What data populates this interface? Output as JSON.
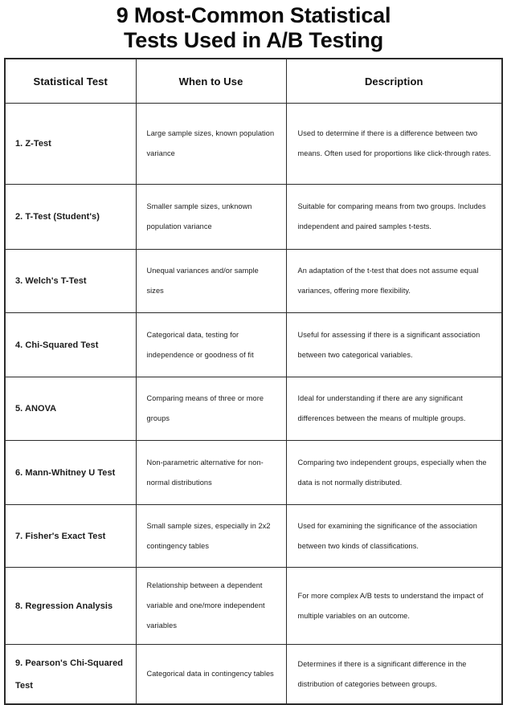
{
  "title": {
    "line1": "9 Most-Common Statistical",
    "line2": "Tests Used in A/B Testing"
  },
  "table": {
    "columns": [
      {
        "header": "Statistical Test"
      },
      {
        "header": "When to Use"
      },
      {
        "header": "Description"
      }
    ],
    "rows": [
      {
        "test": "1. Z-Test",
        "when": "Large sample sizes, known population variance",
        "description": "Used to determine if there is a difference between two means. Often used for proportions like click-through rates."
      },
      {
        "test": "2. T-Test (Student's)",
        "when": "Smaller sample sizes, unknown population variance",
        "description": "Suitable for comparing means from two groups. Includes independent and paired samples t-tests."
      },
      {
        "test": "3. Welch's T-Test",
        "when": "Unequal variances and/or sample sizes",
        "description": "An adaptation of the t-test that does not assume equal variances, offering more flexibility."
      },
      {
        "test": "4. Chi-Squared Test",
        "when": "Categorical data, testing for independence or goodness of fit",
        "description": "Useful for assessing if there is a significant association between two categorical variables."
      },
      {
        "test": "5. ANOVA",
        "when": "Comparing means of three or more groups",
        "description": "Ideal for understanding if there are any significant differences between the means of multiple groups."
      },
      {
        "test": "6. Mann-Whitney U Test",
        "when": "Non-parametric alternative for non-normal distributions",
        "description": "Comparing two independent groups, especially when the data is not normally distributed."
      },
      {
        "test": "7. Fisher's Exact Test",
        "when": "Small sample sizes, especially in 2x2 contingency tables",
        "description": "Used for examining the significance of the association between two kinds of classifications."
      },
      {
        "test": "8. Regression Analysis",
        "when": "Relationship between a dependent variable and one/more independent variables",
        "description": "For more complex A/B tests to understand the impact of multiple variables on an outcome."
      },
      {
        "test": "9. Pearson's Chi-Squared Test",
        "when": "Categorical data in contingency tables",
        "description": "Determines if there is a significant difference in the distribution of categories between groups."
      }
    ]
  },
  "colors": {
    "background": "#ffffff",
    "text": "#111111",
    "border": "#2b2b2b"
  }
}
